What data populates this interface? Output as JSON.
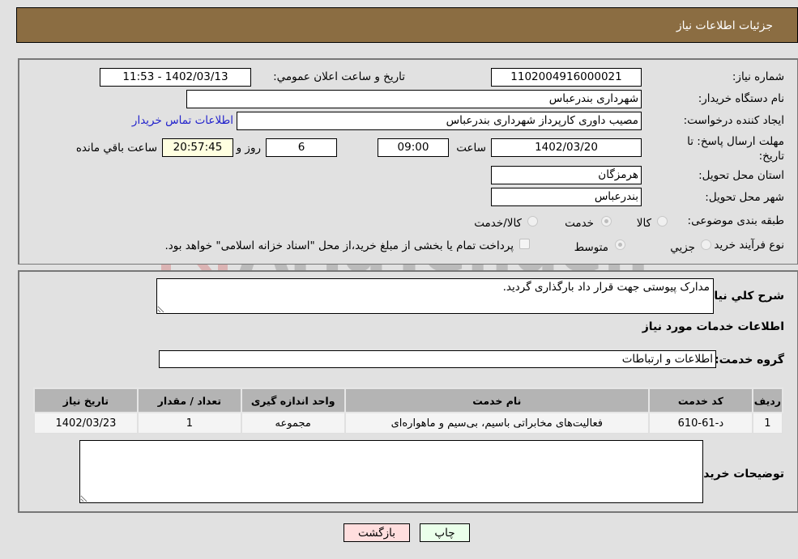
{
  "header": {
    "title": "جزئیات اطلاعات نیاز"
  },
  "details": {
    "need_number_label": "شماره نیاز:",
    "need_number": "1102004916000021",
    "announce_label": "تاریخ و ساعت اعلان عمومي:",
    "announce_value": "1402/03/13 - 11:53",
    "buyer_org_label": "نام دستگاه خریدار:",
    "buyer_org": "شهرداری بندرعباس",
    "creator_label": "ایجاد کننده درخواست:",
    "creator": "مصیب داوری کارپرداز شهرداری بندرعباس",
    "contact_link": "اطلاعات تماس خریدار",
    "deadline_label": "مهلت ارسال پاسخ: تا تاریخ:",
    "deadline_date": "1402/03/20",
    "time_label": "ساعت",
    "deadline_time": "09:00",
    "days_value": "6",
    "days_label": "روز و",
    "remaining_time": "20:57:45",
    "remaining_label": "ساعت باقي مانده",
    "province_label": "استان محل تحویل:",
    "province": "هرمزگان",
    "city_label": "شهر محل تحویل:",
    "city": "بندرعباس",
    "category_label": "طبقه بندی موضوعی:",
    "category_options": [
      {
        "label": "کالا",
        "selected": false
      },
      {
        "label": "خدمت",
        "selected": true
      },
      {
        "label": "کالا/خدمت",
        "selected": false
      }
    ],
    "process_label": "نوع فرآیند خرید :",
    "process_options": [
      {
        "label": "جزیي",
        "selected": false
      },
      {
        "label": "متوسط",
        "selected": true
      }
    ],
    "treasury_note": "پرداخت تمام یا بخشی از مبلغ خرید،از محل \"اسناد خزانه اسلامی\" خواهد بود.",
    "treasury_checked": false
  },
  "summary": {
    "label": "شرح کلي نیاز:",
    "value": "مدارک پیوستی جهت قرار داد بارگذاری گردید."
  },
  "services": {
    "section_title": "اطلاعات خدمات مورد نیاز",
    "group_label": "گروه خدمت:",
    "group_value": "اطلاعات و ارتباطات",
    "columns": [
      "ردیف",
      "کد خدمت",
      "نام خدمت",
      "واحد اندازه گیری",
      "تعداد / مقدار",
      "تاریخ نیاز"
    ],
    "rows": [
      [
        "1",
        "د-61-610",
        "فعالیت‌های مخابراتی باسیم، بی‌سیم و ماهواره‌ای",
        "مجموعه",
        "1",
        "1402/03/23"
      ]
    ]
  },
  "buyer_notes": {
    "label": "توضیحات خریدار:",
    "value": ""
  },
  "buttons": {
    "print": "چاپ",
    "back": "بازگشت"
  },
  "colors": {
    "header_bg": "#8b6d42",
    "print_bg": "#eaffea",
    "back_bg": "#ffdede",
    "link": "#2222cc"
  }
}
